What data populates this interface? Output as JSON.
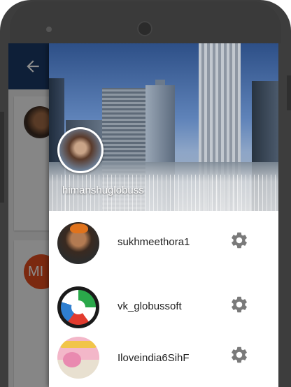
{
  "header": {
    "username": "himanshuglobuss"
  },
  "accounts": [
    {
      "name": "sukhmeethora1",
      "avatar": "person-orange-turban-avatar"
    },
    {
      "name": "vk_globussoft",
      "avatar": "colorful-wheel-logo-avatar"
    },
    {
      "name": "Iloveindia6SihF",
      "avatar": "angry-birds-game-art-avatar"
    }
  ],
  "icons": {
    "back": "back-arrow-icon",
    "settings": "gear-icon"
  },
  "background": {
    "avatar_letters": "MI"
  },
  "colors": {
    "appbar": "#1a3a66",
    "gear": "#7a7a7a",
    "badge": "#e14b1e"
  }
}
